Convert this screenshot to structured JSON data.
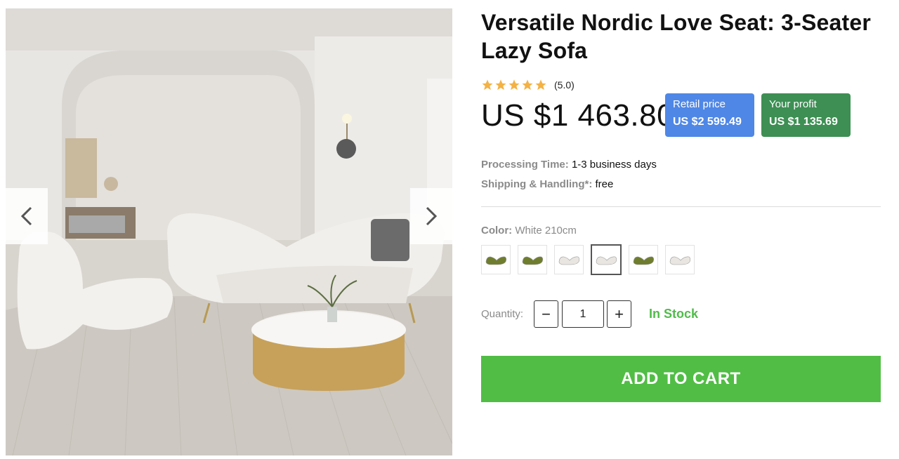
{
  "product": {
    "title": "Versatile Nordic Love Seat: 3-Seater Lazy Sofa",
    "rating": {
      "stars": 5,
      "value_text": "(5.0)"
    },
    "price": "US $1 463.80",
    "retail": {
      "label": "Retail price",
      "value": "US $2 599.49"
    },
    "profit": {
      "label": "Your profit",
      "value": "US $1 135.69"
    },
    "processing": {
      "label": "Processing Time:",
      "value": "1-3 business days"
    },
    "shipping": {
      "label": "Shipping & Handling*:",
      "value": "free"
    },
    "color": {
      "label": "Color:",
      "value": "White 210cm"
    },
    "swatches": [
      {
        "name": "green-sofa",
        "color": "#6f7d2e"
      },
      {
        "name": "green-sofa-2",
        "color": "#6f7d2e"
      },
      {
        "name": "white-sofa",
        "color": "#e9e6e1"
      },
      {
        "name": "white-210cm",
        "color": "#e9e6e1",
        "selected": true
      },
      {
        "name": "green-lounge",
        "color": "#6f7d2e"
      },
      {
        "name": "white-lounge",
        "color": "#e9e6e1"
      }
    ],
    "quantity": {
      "label": "Quantity:",
      "value": "1",
      "minus": "−",
      "plus": "+"
    },
    "stock": "In Stock",
    "add_to_cart": "ADD TO CART"
  },
  "colors": {
    "retail_badge": "#4f87e6",
    "profit_badge": "#3d8f53",
    "cart_button": "#51bd45",
    "stock_text": "#4fbc48",
    "star": "#f3b244"
  },
  "icons": {
    "gallery_prev": "chevron-left-icon",
    "gallery_next": "chevron-right-icon",
    "rating": "star-icon"
  }
}
